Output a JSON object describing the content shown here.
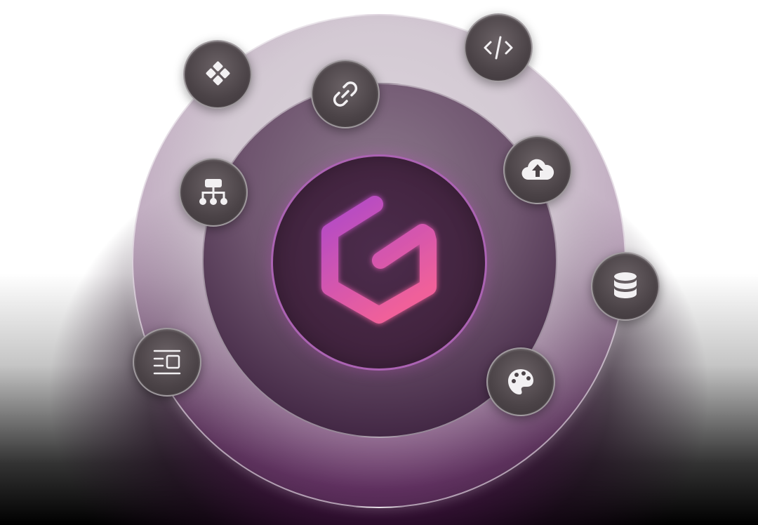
{
  "scene": {
    "center_logo": "brand-hexagon-g-logo",
    "colors": {
      "logo_gradient_start": "#b04ac8",
      "logo_gradient_end": "#f0609a",
      "inner_ring_border": "#be6ec8",
      "node_fill": "#4b4347",
      "glow": "#6e2369"
    },
    "nodes": [
      {
        "icon": "components-icon"
      },
      {
        "icon": "link-icon"
      },
      {
        "icon": "code-icon"
      },
      {
        "icon": "sitemap-icon"
      },
      {
        "icon": "cloud-upload-icon"
      },
      {
        "icon": "database-icon"
      },
      {
        "icon": "layout-icon"
      },
      {
        "icon": "palette-icon"
      }
    ]
  }
}
